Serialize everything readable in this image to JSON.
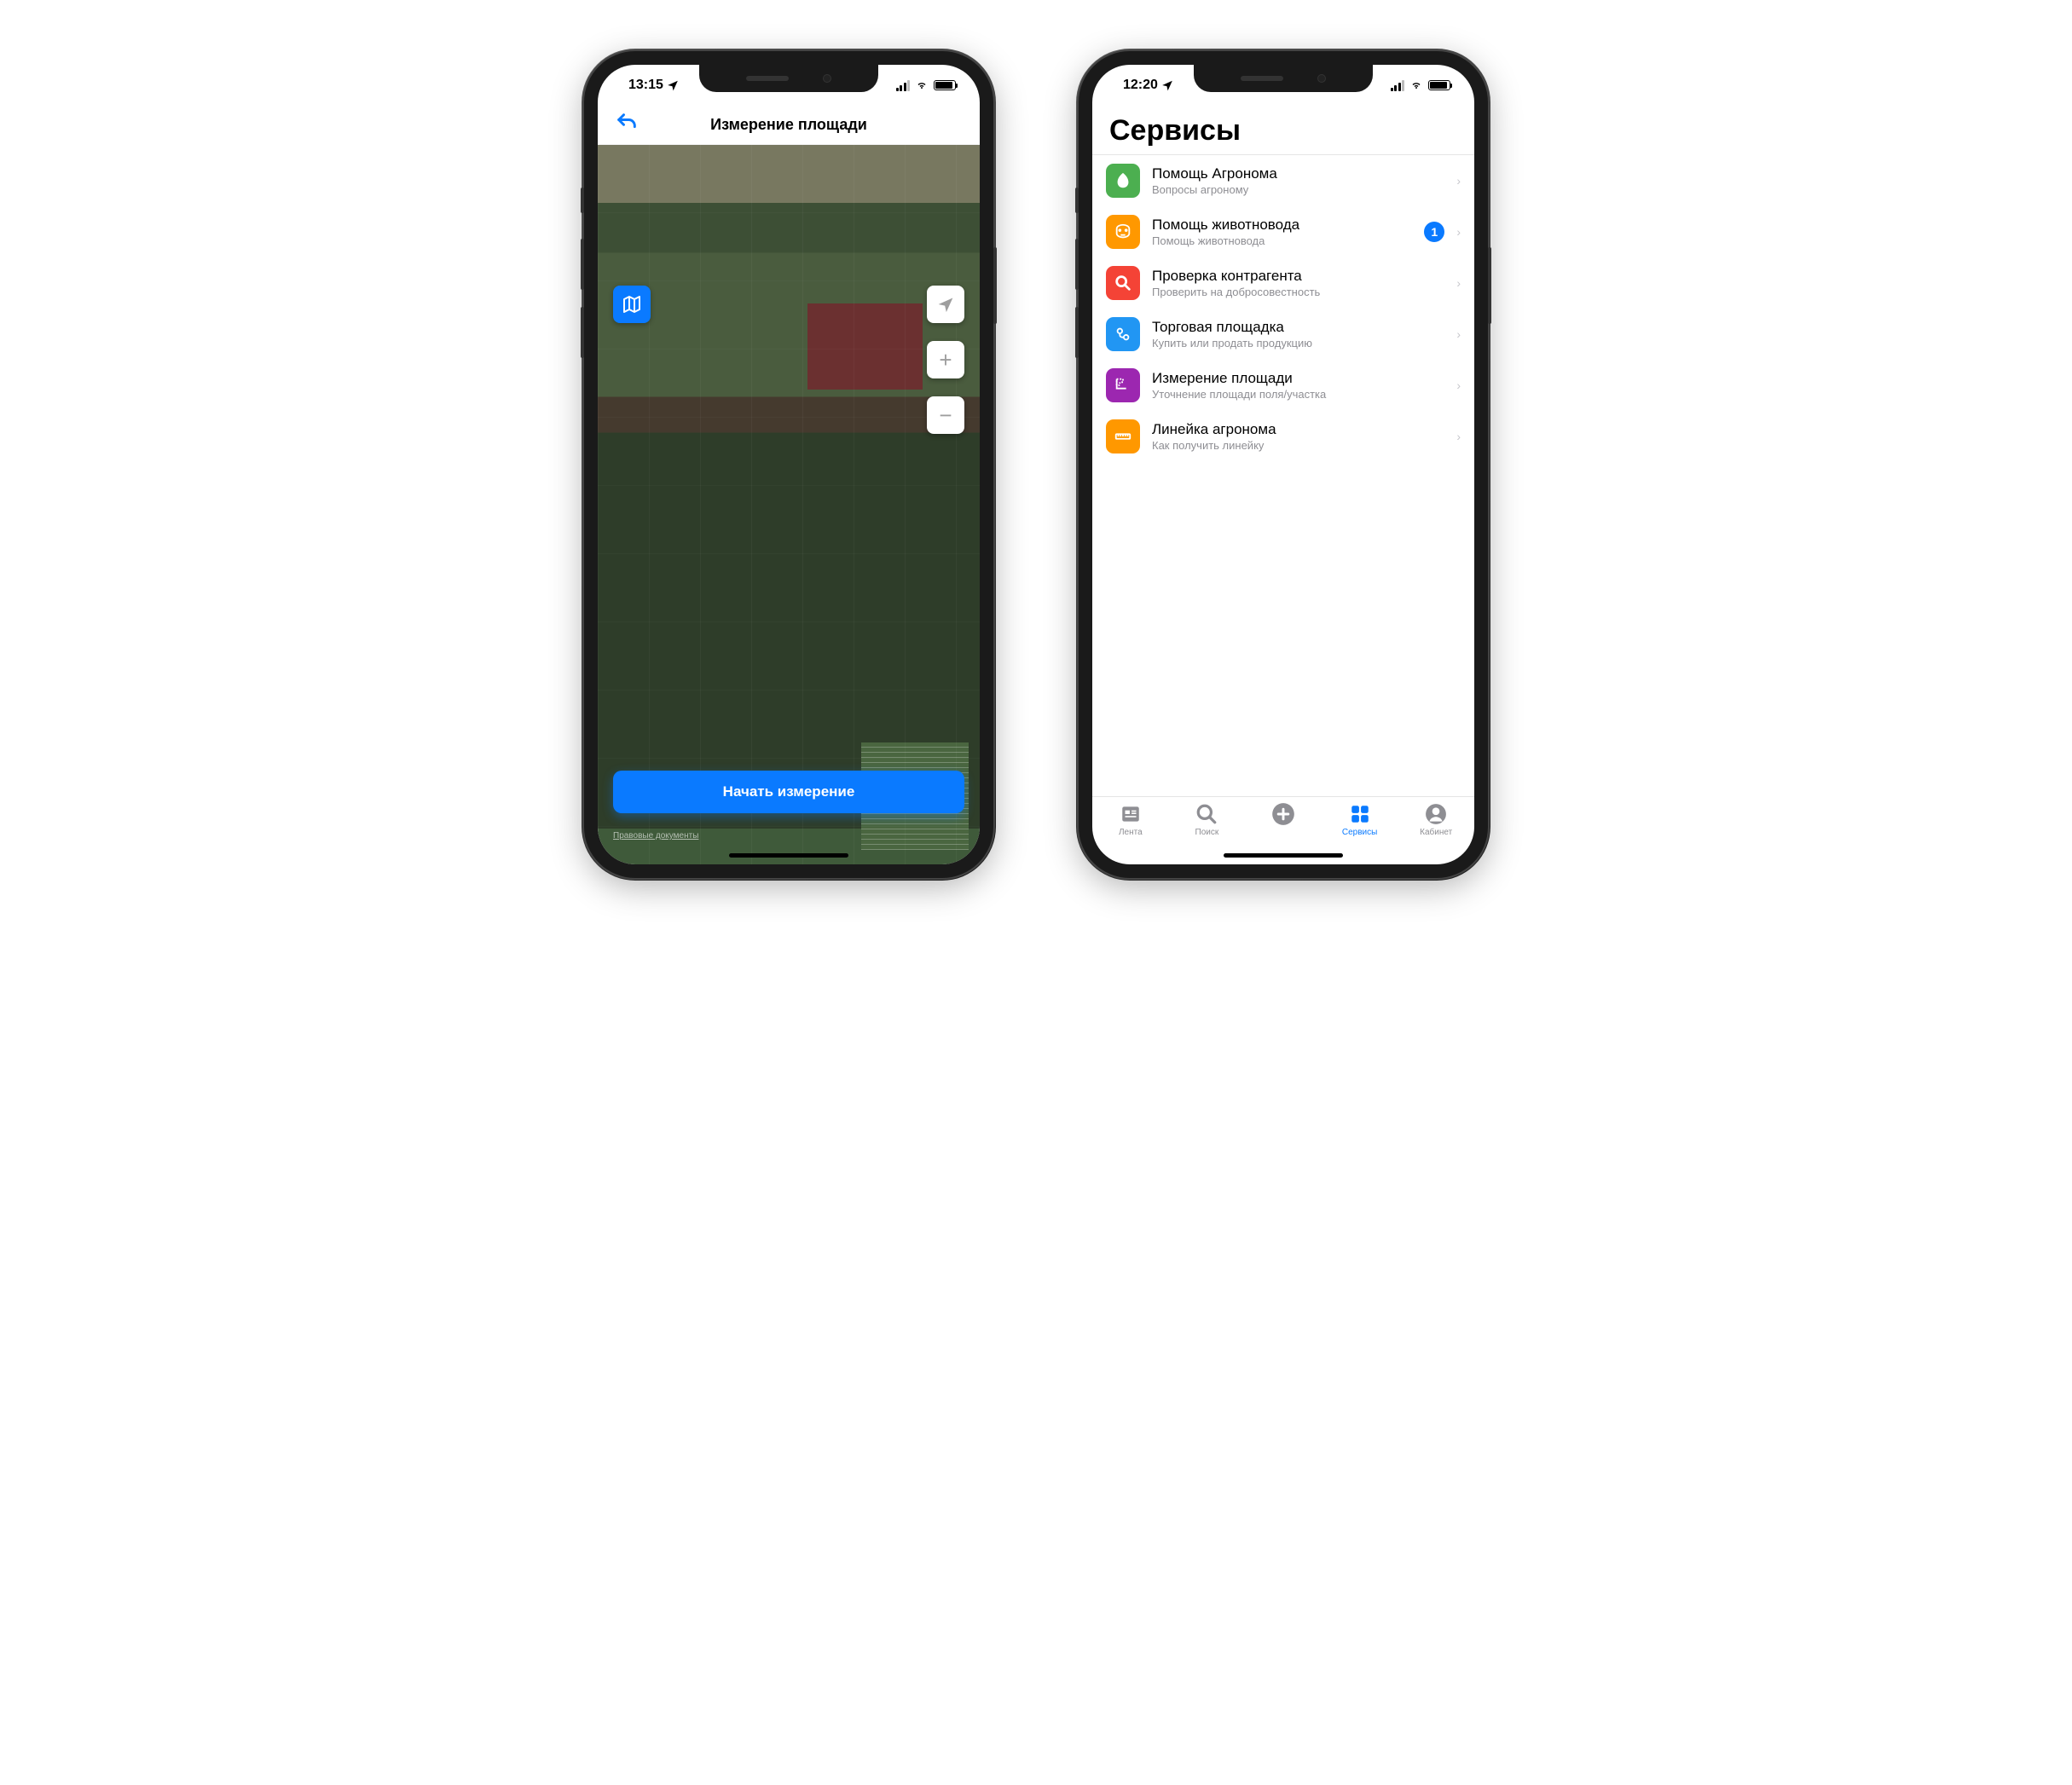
{
  "phone1": {
    "status_time": "13:15",
    "nav_title": "Измерение площади",
    "primary_button": "Начать измерение",
    "legal": "Правовые документы"
  },
  "phone2": {
    "status_time": "12:20",
    "page_title": "Сервисы",
    "services": [
      {
        "title": "Помощь Агронома",
        "sub": "Вопросы агроному",
        "icon": "leaf",
        "color": "#4caf50",
        "badge": null
      },
      {
        "title": "Помощь животновода",
        "sub": "Помощь животновода",
        "icon": "cow",
        "color": "#ff9800",
        "badge": "1"
      },
      {
        "title": "Проверка контрагента",
        "sub": "Проверить на добросовестность",
        "icon": "search",
        "color": "#f44336",
        "badge": null
      },
      {
        "title": "Торговая площадка",
        "sub": "Купить или продать продукцию",
        "icon": "market",
        "color": "#2196f3",
        "badge": null
      },
      {
        "title": "Измерение площади",
        "sub": "Уточнение площади поля/участка",
        "icon": "ruler-area",
        "color": "#9c27b0",
        "badge": null
      },
      {
        "title": "Линейка агронома",
        "sub": "Как получить линейку",
        "icon": "ruler",
        "color": "#ff9800",
        "badge": null
      }
    ],
    "tabs": [
      {
        "label": "Лента",
        "icon": "feed",
        "active": false
      },
      {
        "label": "Поиск",
        "icon": "search",
        "active": false
      },
      {
        "label": "",
        "icon": "add",
        "active": false
      },
      {
        "label": "Сервисы",
        "icon": "grid",
        "active": true
      },
      {
        "label": "Кабинет",
        "icon": "profile",
        "active": false
      }
    ]
  }
}
